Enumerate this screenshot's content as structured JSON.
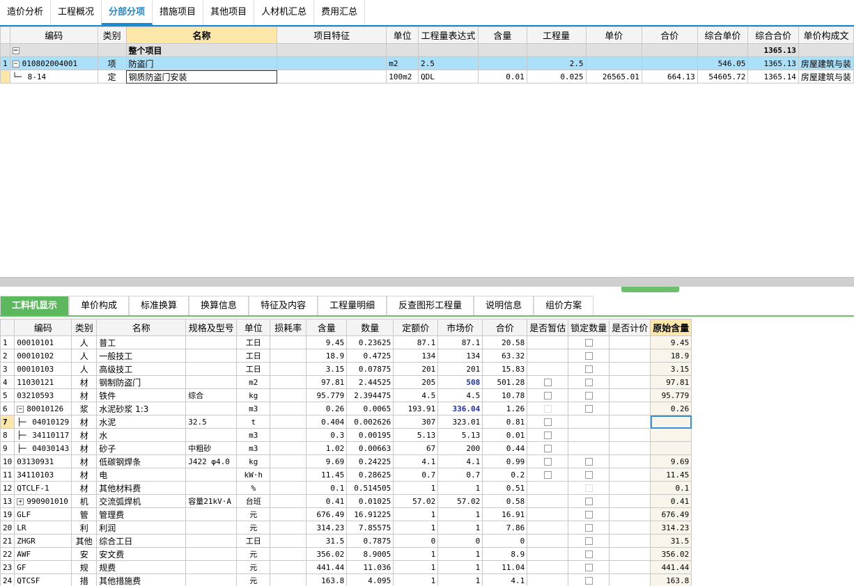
{
  "main_tabs": [
    "造价分析",
    "工程概况",
    "分部分项",
    "措施项目",
    "其他项目",
    "人材机汇总",
    "费用汇总"
  ],
  "top_table": {
    "headers": [
      "编码",
      "类别",
      "名称",
      "项目特征",
      "单位",
      "工程量表达式",
      "含量",
      "工程量",
      "单价",
      "合价",
      "综合单价",
      "综合合价",
      "单价构成文"
    ],
    "section": {
      "name": "整个项目",
      "total": "1365.13"
    },
    "rows": [
      {
        "no": "1",
        "code": "010802004001",
        "type": "项",
        "name": "防盗门",
        "feature": "",
        "unit": "m2",
        "expr": "2.5",
        "content": "",
        "qty": "2.5",
        "price": "",
        "sum": "",
        "uprice": "546.05",
        "usum": "1365.13",
        "compose": "房屋建筑与装"
      },
      {
        "no": "",
        "code": "8-14",
        "type": "定",
        "name": "钢质防盗门安装",
        "feature": "",
        "unit": "100m2",
        "expr": "QDL",
        "content": "0.01",
        "qty": "0.025",
        "price": "26565.01",
        "sum": "664.13",
        "uprice": "54605.72",
        "usum": "1365.14",
        "compose": "房屋建筑与装"
      }
    ]
  },
  "bottom_tabs": [
    "工料机显示",
    "单价构成",
    "标准换算",
    "换算信息",
    "特征及内容",
    "工程量明细",
    "反查图形工程量",
    "说明信息",
    "组价方案"
  ],
  "bottom_table": {
    "headers": [
      "编码",
      "类别",
      "名称",
      "规格及型号",
      "单位",
      "损耗率",
      "含量",
      "数量",
      "定额价",
      "市场价",
      "合价",
      "是否暂估",
      "锁定数量",
      "是否计价",
      "原始含量"
    ],
    "rows": [
      {
        "no": "1",
        "code": "00010101",
        "type": "人",
        "name": "普工",
        "spec": "",
        "unit": "工日",
        "loss": "",
        "content": "9.45",
        "qty": "0.23625",
        "quota": "87.1",
        "market": "87.1",
        "sum": "20.58",
        "est": "none",
        "lock": "box",
        "orig": "9.45"
      },
      {
        "no": "2",
        "code": "00010102",
        "type": "人",
        "name": "一般技工",
        "spec": "",
        "unit": "工日",
        "loss": "",
        "content": "18.9",
        "qty": "0.4725",
        "quota": "134",
        "market": "134",
        "sum": "63.32",
        "est": "none",
        "lock": "box",
        "orig": "18.9"
      },
      {
        "no": "3",
        "code": "00010103",
        "type": "人",
        "name": "高级技工",
        "spec": "",
        "unit": "工日",
        "loss": "",
        "content": "3.15",
        "qty": "0.07875",
        "quota": "201",
        "market": "201",
        "sum": "15.83",
        "est": "none",
        "lock": "box",
        "orig": "3.15"
      },
      {
        "no": "4",
        "code": "11030121",
        "type": "材",
        "name": "钢制防盗门",
        "spec": "",
        "unit": "m2",
        "loss": "",
        "content": "97.81",
        "qty": "2.44525",
        "quota": "205",
        "market": "508",
        "sum": "501.28",
        "est": "box",
        "lock": "box",
        "orig": "97.81",
        "blue": true
      },
      {
        "no": "5",
        "code": "03210593",
        "type": "材",
        "name": "铁件",
        "spec": "综合",
        "unit": "kg",
        "loss": "",
        "content": "95.779",
        "qty": "2.394475",
        "quota": "4.5",
        "market": "4.5",
        "sum": "10.78",
        "est": "box",
        "lock": "box",
        "orig": "95.779"
      },
      {
        "no": "6",
        "code": "80010126",
        "type": "浆",
        "name": "水泥砂浆 1:3",
        "spec": "",
        "unit": "m3",
        "loss": "",
        "content": "0.26",
        "qty": "0.0065",
        "quota": "193.91",
        "market": "336.04",
        "sum": "1.26",
        "est": "dim",
        "lock": "box",
        "orig": "0.26",
        "blue": true,
        "expander": "−"
      },
      {
        "no": "7",
        "code": "04010129",
        "type": "材",
        "name": "水泥",
        "spec": "32.5",
        "unit": "t",
        "loss": "",
        "content": "0.404",
        "qty": "0.002626",
        "quota": "307",
        "market": "323.01",
        "sum": "0.81",
        "est": "box",
        "lock": "none",
        "orig": "",
        "child": true,
        "edit": true
      },
      {
        "no": "8",
        "code": "34110117",
        "type": "材",
        "name": "水",
        "spec": "",
        "unit": "m3",
        "loss": "",
        "content": "0.3",
        "qty": "0.00195",
        "quota": "5.13",
        "market": "5.13",
        "sum": "0.01",
        "est": "box",
        "lock": "none",
        "orig": "",
        "child": true
      },
      {
        "no": "9",
        "code": "04030143",
        "type": "材",
        "name": "砂子",
        "spec": "中粗砂",
        "unit": "m3",
        "loss": "",
        "content": "1.02",
        "qty": "0.00663",
        "quota": "67",
        "market": "200",
        "sum": "0.44",
        "est": "box",
        "lock": "none",
        "orig": "",
        "child": true
      },
      {
        "no": "10",
        "code": "03130931",
        "type": "材",
        "name": "低碳钢焊条",
        "spec": "J422 φ4.0",
        "unit": "kg",
        "loss": "",
        "content": "9.69",
        "qty": "0.24225",
        "quota": "4.1",
        "market": "4.1",
        "sum": "0.99",
        "est": "box",
        "lock": "box",
        "orig": "9.69"
      },
      {
        "no": "11",
        "code": "34110103",
        "type": "材",
        "name": "电",
        "spec": "",
        "unit": "kW·h",
        "loss": "",
        "content": "11.45",
        "qty": "0.28625",
        "quota": "0.7",
        "market": "0.7",
        "sum": "0.2",
        "est": "box",
        "lock": "box",
        "orig": "11.45"
      },
      {
        "no": "12",
        "code": "QTCLF-1",
        "type": "材",
        "name": "其他材料费",
        "spec": "",
        "unit": "%",
        "loss": "",
        "content": "0.1",
        "qty": "0.514505",
        "quota": "1",
        "market": "1",
        "sum": "0.51",
        "est": "none",
        "lock": "dim",
        "orig": "0.1"
      },
      {
        "no": "13",
        "code": "990901010",
        "type": "机",
        "name": "交流弧焊机",
        "spec": "容量21kV·A",
        "unit": "台班",
        "loss": "",
        "content": "0.41",
        "qty": "0.01025",
        "quota": "57.02",
        "market": "57.02",
        "sum": "0.58",
        "est": "none",
        "lock": "box",
        "orig": "0.41",
        "expander": "+"
      },
      {
        "no": "19",
        "code": "GLF",
        "type": "管",
        "name": "管理费",
        "spec": "",
        "unit": "元",
        "loss": "",
        "content": "676.49",
        "qty": "16.91225",
        "quota": "1",
        "market": "1",
        "sum": "16.91",
        "est": "none",
        "lock": "box",
        "orig": "676.49"
      },
      {
        "no": "20",
        "code": "LR",
        "type": "利",
        "name": "利润",
        "spec": "",
        "unit": "元",
        "loss": "",
        "content": "314.23",
        "qty": "7.85575",
        "quota": "1",
        "market": "1",
        "sum": "7.86",
        "est": "none",
        "lock": "box",
        "orig": "314.23"
      },
      {
        "no": "21",
        "code": "ZHGR",
        "type": "其他",
        "name": "综合工日",
        "spec": "",
        "unit": "工日",
        "loss": "",
        "content": "31.5",
        "qty": "0.7875",
        "quota": "0",
        "market": "0",
        "sum": "0",
        "est": "none",
        "lock": "box",
        "orig": "31.5"
      },
      {
        "no": "22",
        "code": "AWF",
        "type": "安",
        "name": "安文费",
        "spec": "",
        "unit": "元",
        "loss": "",
        "content": "356.02",
        "qty": "8.9005",
        "quota": "1",
        "market": "1",
        "sum": "8.9",
        "est": "none",
        "lock": "box",
        "orig": "356.02"
      },
      {
        "no": "23",
        "code": "GF",
        "type": "规",
        "name": "规费",
        "spec": "",
        "unit": "元",
        "loss": "",
        "content": "441.44",
        "qty": "11.036",
        "quota": "1",
        "market": "1",
        "sum": "11.04",
        "est": "none",
        "lock": "box",
        "orig": "441.44"
      },
      {
        "no": "24",
        "code": "QTCSF",
        "type": "措",
        "name": "其他措施费",
        "spec": "",
        "unit": "元",
        "loss": "",
        "content": "163.8",
        "qty": "4.095",
        "quota": "1",
        "market": "1",
        "sum": "4.1",
        "est": "none",
        "lock": "box",
        "orig": "163.8"
      }
    ]
  }
}
